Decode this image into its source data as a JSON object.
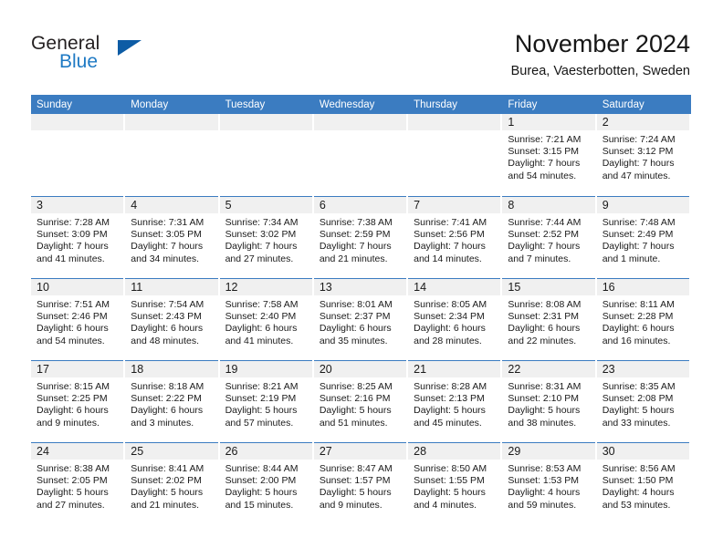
{
  "logo": {
    "word_one": "General",
    "word_two": "Blue",
    "triangle_color": "#0d5ca5",
    "blue_text_color": "#1f7ac4"
  },
  "header": {
    "title": "November 2024",
    "location": "Burea, Vaesterbotten, Sweden"
  },
  "theme": {
    "header_blue": "#3b7cc1",
    "row_rule_blue": "#3b7cc1",
    "daynum_band": "#f0f0f0"
  },
  "weekdays": [
    "Sunday",
    "Monday",
    "Tuesday",
    "Wednesday",
    "Thursday",
    "Friday",
    "Saturday"
  ],
  "weeks": [
    [
      {
        "day": "",
        "empty": true
      },
      {
        "day": "",
        "empty": true
      },
      {
        "day": "",
        "empty": true
      },
      {
        "day": "",
        "empty": true
      },
      {
        "day": "",
        "empty": true
      },
      {
        "day": "1",
        "sunrise": "Sunrise: 7:21 AM",
        "sunset": "Sunset: 3:15 PM",
        "daylight1": "Daylight: 7 hours",
        "daylight2": "and 54 minutes."
      },
      {
        "day": "2",
        "sunrise": "Sunrise: 7:24 AM",
        "sunset": "Sunset: 3:12 PM",
        "daylight1": "Daylight: 7 hours",
        "daylight2": "and 47 minutes."
      }
    ],
    [
      {
        "day": "3",
        "sunrise": "Sunrise: 7:28 AM",
        "sunset": "Sunset: 3:09 PM",
        "daylight1": "Daylight: 7 hours",
        "daylight2": "and 41 minutes."
      },
      {
        "day": "4",
        "sunrise": "Sunrise: 7:31 AM",
        "sunset": "Sunset: 3:05 PM",
        "daylight1": "Daylight: 7 hours",
        "daylight2": "and 34 minutes."
      },
      {
        "day": "5",
        "sunrise": "Sunrise: 7:34 AM",
        "sunset": "Sunset: 3:02 PM",
        "daylight1": "Daylight: 7 hours",
        "daylight2": "and 27 minutes."
      },
      {
        "day": "6",
        "sunrise": "Sunrise: 7:38 AM",
        "sunset": "Sunset: 2:59 PM",
        "daylight1": "Daylight: 7 hours",
        "daylight2": "and 21 minutes."
      },
      {
        "day": "7",
        "sunrise": "Sunrise: 7:41 AM",
        "sunset": "Sunset: 2:56 PM",
        "daylight1": "Daylight: 7 hours",
        "daylight2": "and 14 minutes."
      },
      {
        "day": "8",
        "sunrise": "Sunrise: 7:44 AM",
        "sunset": "Sunset: 2:52 PM",
        "daylight1": "Daylight: 7 hours",
        "daylight2": "and 7 minutes."
      },
      {
        "day": "9",
        "sunrise": "Sunrise: 7:48 AM",
        "sunset": "Sunset: 2:49 PM",
        "daylight1": "Daylight: 7 hours",
        "daylight2": "and 1 minute."
      }
    ],
    [
      {
        "day": "10",
        "sunrise": "Sunrise: 7:51 AM",
        "sunset": "Sunset: 2:46 PM",
        "daylight1": "Daylight: 6 hours",
        "daylight2": "and 54 minutes."
      },
      {
        "day": "11",
        "sunrise": "Sunrise: 7:54 AM",
        "sunset": "Sunset: 2:43 PM",
        "daylight1": "Daylight: 6 hours",
        "daylight2": "and 48 minutes."
      },
      {
        "day": "12",
        "sunrise": "Sunrise: 7:58 AM",
        "sunset": "Sunset: 2:40 PM",
        "daylight1": "Daylight: 6 hours",
        "daylight2": "and 41 minutes."
      },
      {
        "day": "13",
        "sunrise": "Sunrise: 8:01 AM",
        "sunset": "Sunset: 2:37 PM",
        "daylight1": "Daylight: 6 hours",
        "daylight2": "and 35 minutes."
      },
      {
        "day": "14",
        "sunrise": "Sunrise: 8:05 AM",
        "sunset": "Sunset: 2:34 PM",
        "daylight1": "Daylight: 6 hours",
        "daylight2": "and 28 minutes."
      },
      {
        "day": "15",
        "sunrise": "Sunrise: 8:08 AM",
        "sunset": "Sunset: 2:31 PM",
        "daylight1": "Daylight: 6 hours",
        "daylight2": "and 22 minutes."
      },
      {
        "day": "16",
        "sunrise": "Sunrise: 8:11 AM",
        "sunset": "Sunset: 2:28 PM",
        "daylight1": "Daylight: 6 hours",
        "daylight2": "and 16 minutes."
      }
    ],
    [
      {
        "day": "17",
        "sunrise": "Sunrise: 8:15 AM",
        "sunset": "Sunset: 2:25 PM",
        "daylight1": "Daylight: 6 hours",
        "daylight2": "and 9 minutes."
      },
      {
        "day": "18",
        "sunrise": "Sunrise: 8:18 AM",
        "sunset": "Sunset: 2:22 PM",
        "daylight1": "Daylight: 6 hours",
        "daylight2": "and 3 minutes."
      },
      {
        "day": "19",
        "sunrise": "Sunrise: 8:21 AM",
        "sunset": "Sunset: 2:19 PM",
        "daylight1": "Daylight: 5 hours",
        "daylight2": "and 57 minutes."
      },
      {
        "day": "20",
        "sunrise": "Sunrise: 8:25 AM",
        "sunset": "Sunset: 2:16 PM",
        "daylight1": "Daylight: 5 hours",
        "daylight2": "and 51 minutes."
      },
      {
        "day": "21",
        "sunrise": "Sunrise: 8:28 AM",
        "sunset": "Sunset: 2:13 PM",
        "daylight1": "Daylight: 5 hours",
        "daylight2": "and 45 minutes."
      },
      {
        "day": "22",
        "sunrise": "Sunrise: 8:31 AM",
        "sunset": "Sunset: 2:10 PM",
        "daylight1": "Daylight: 5 hours",
        "daylight2": "and 38 minutes."
      },
      {
        "day": "23",
        "sunrise": "Sunrise: 8:35 AM",
        "sunset": "Sunset: 2:08 PM",
        "daylight1": "Daylight: 5 hours",
        "daylight2": "and 33 minutes."
      }
    ],
    [
      {
        "day": "24",
        "sunrise": "Sunrise: 8:38 AM",
        "sunset": "Sunset: 2:05 PM",
        "daylight1": "Daylight: 5 hours",
        "daylight2": "and 27 minutes."
      },
      {
        "day": "25",
        "sunrise": "Sunrise: 8:41 AM",
        "sunset": "Sunset: 2:02 PM",
        "daylight1": "Daylight: 5 hours",
        "daylight2": "and 21 minutes."
      },
      {
        "day": "26",
        "sunrise": "Sunrise: 8:44 AM",
        "sunset": "Sunset: 2:00 PM",
        "daylight1": "Daylight: 5 hours",
        "daylight2": "and 15 minutes."
      },
      {
        "day": "27",
        "sunrise": "Sunrise: 8:47 AM",
        "sunset": "Sunset: 1:57 PM",
        "daylight1": "Daylight: 5 hours",
        "daylight2": "and 9 minutes."
      },
      {
        "day": "28",
        "sunrise": "Sunrise: 8:50 AM",
        "sunset": "Sunset: 1:55 PM",
        "daylight1": "Daylight: 5 hours",
        "daylight2": "and 4 minutes."
      },
      {
        "day": "29",
        "sunrise": "Sunrise: 8:53 AM",
        "sunset": "Sunset: 1:53 PM",
        "daylight1": "Daylight: 4 hours",
        "daylight2": "and 59 minutes."
      },
      {
        "day": "30",
        "sunrise": "Sunrise: 8:56 AM",
        "sunset": "Sunset: 1:50 PM",
        "daylight1": "Daylight: 4 hours",
        "daylight2": "and 53 minutes."
      }
    ]
  ]
}
